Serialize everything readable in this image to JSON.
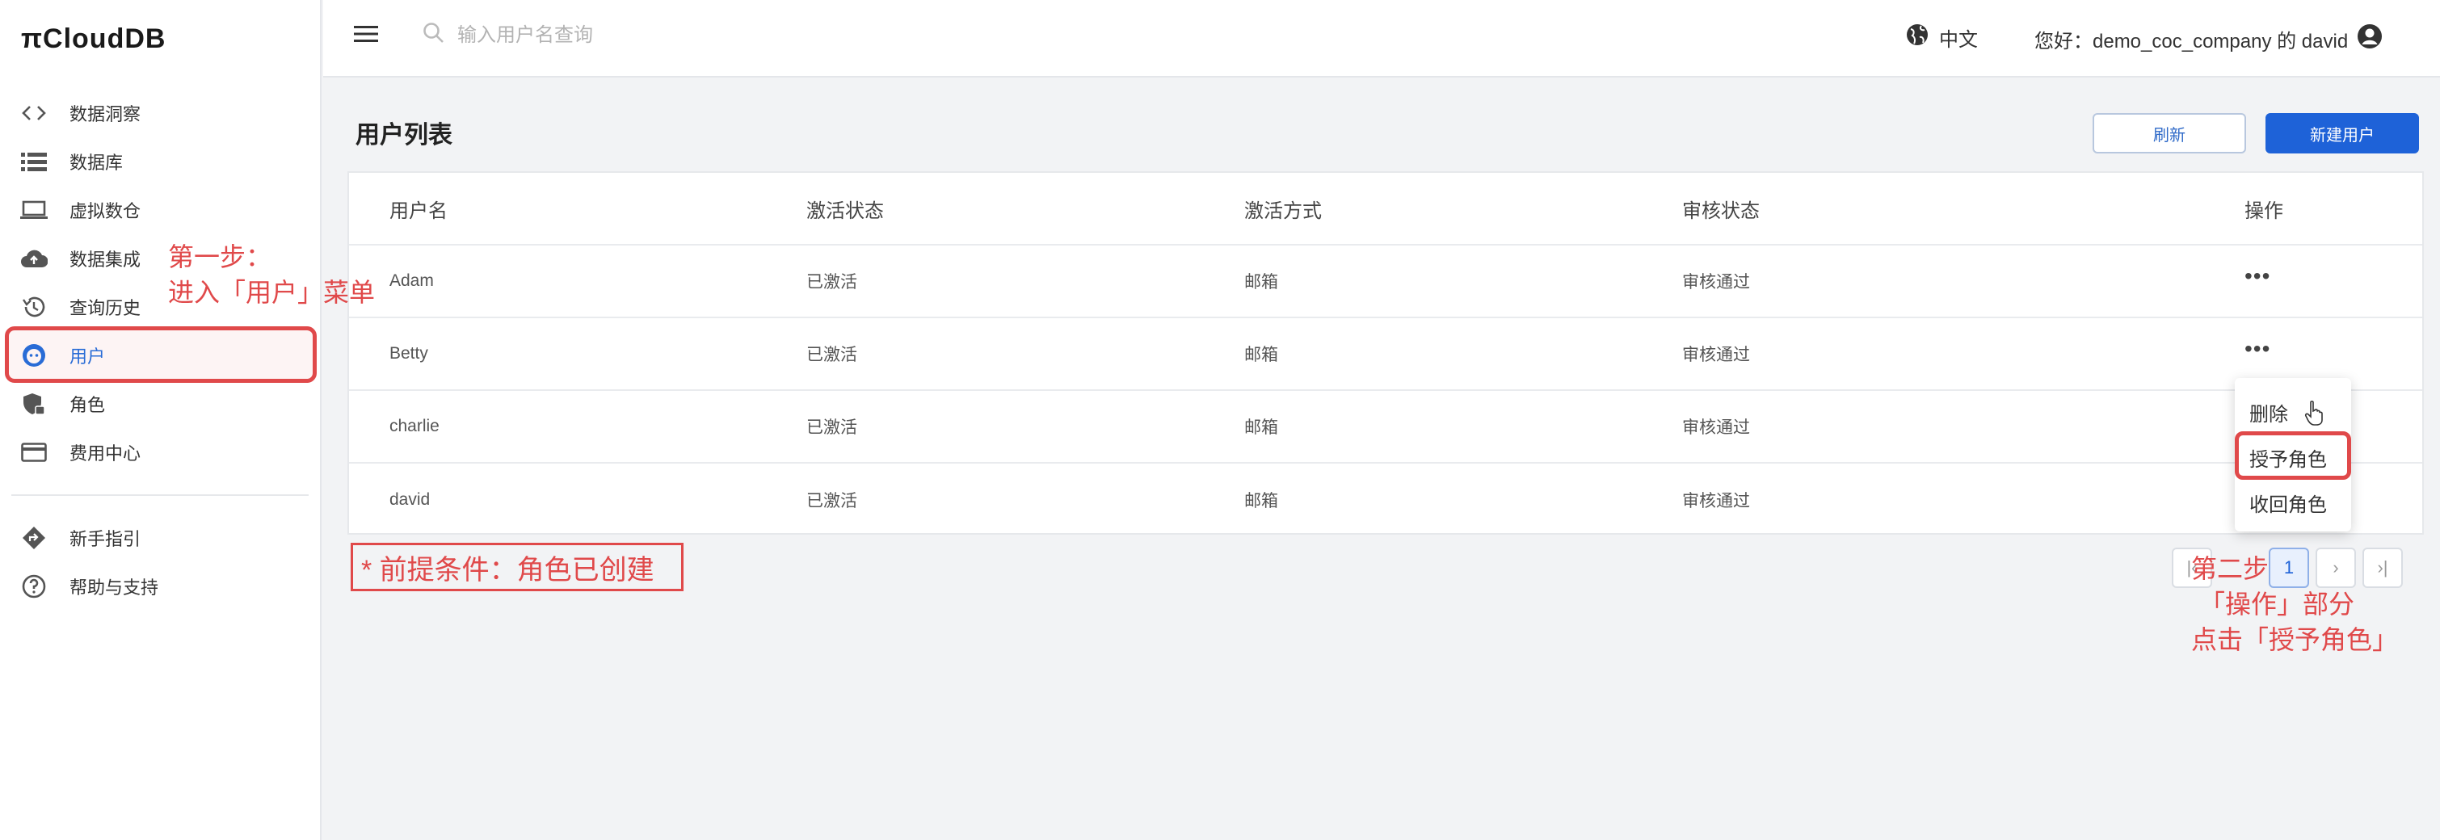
{
  "app": {
    "logo_text": "πCloudDB"
  },
  "sidebar": {
    "items": [
      {
        "label": "数据洞察",
        "icon": "code-brackets-icon"
      },
      {
        "label": "数据库",
        "icon": "list-icon"
      },
      {
        "label": "虚拟数仓",
        "icon": "laptop-icon"
      },
      {
        "label": "数据集成",
        "icon": "cloud-upload-icon"
      },
      {
        "label": "查询历史",
        "icon": "history-icon"
      },
      {
        "label": "用户",
        "icon": "user-face-icon",
        "active": true
      },
      {
        "label": "角色",
        "icon": "shield-lock-icon"
      },
      {
        "label": "费用中心",
        "icon": "credit-card-icon"
      },
      {
        "label": "新手指引",
        "icon": "direction-sign-icon"
      },
      {
        "label": "帮助与支持",
        "icon": "help-circle-icon"
      }
    ]
  },
  "header": {
    "search_placeholder": "输入用户名查询",
    "language": "中文",
    "greeting": "您好：demo_coc_company 的 david"
  },
  "main": {
    "title": "用户列表",
    "refresh_label": "刷新",
    "new_user_label": "新建用户",
    "table": {
      "columns": [
        "用户名",
        "激活状态",
        "激活方式",
        "审核状态",
        "操作"
      ],
      "rows": [
        {
          "name": "Adam",
          "status": "已激活",
          "method": "邮箱",
          "review": "审核通过",
          "op": "•••"
        },
        {
          "name": "Betty",
          "status": "已激活",
          "method": "邮箱",
          "review": "审核通过",
          "op": "•••"
        },
        {
          "name": "charlie",
          "status": "已激活",
          "method": "邮箱",
          "review": "审核通过",
          "op": ""
        },
        {
          "name": "david",
          "status": "已激活",
          "method": "邮箱",
          "review": "审核通过",
          "op": ""
        }
      ]
    },
    "row_menu": [
      "删除",
      "授予角色",
      "收回角色"
    ],
    "pagination": {
      "current_page": "1",
      "next": "›",
      "last": "›|",
      "first": "|‹"
    }
  },
  "annotations": {
    "step1_line1": "第一步：",
    "step1_line2": "进入「用户」菜单",
    "prerequisite": "* 前提条件：角色已创建",
    "step2_line1": "第二步",
    "step2_line2": "「操作」部分",
    "step2_line3": "点击「授予角色」"
  },
  "colors": {
    "accent": "#1e62d8",
    "annotation": "#e0494a",
    "background": "#f2f3f5"
  }
}
